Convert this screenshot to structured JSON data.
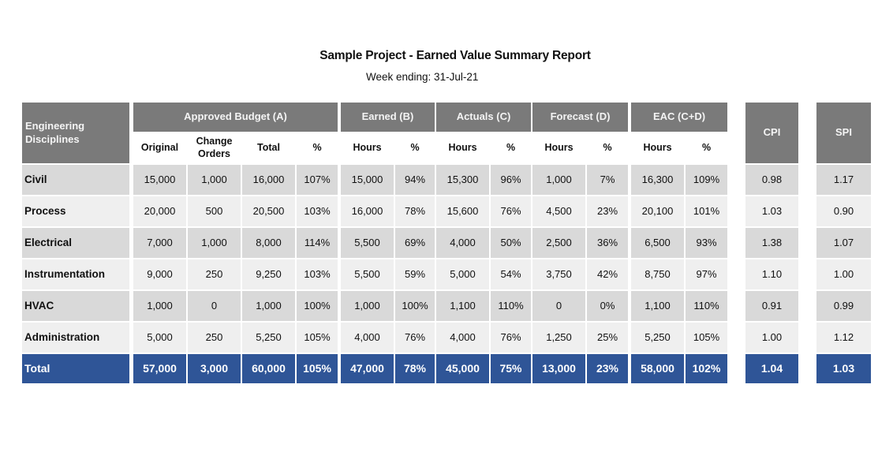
{
  "report": {
    "title": "Sample Project - Earned Value Summary Report",
    "subtitle": "Week ending:  31-Jul-21"
  },
  "colors": {
    "header_bg": "#7a7a7a",
    "row_dark": "#d9d9d9",
    "row_light": "#efefef",
    "total_bg": "#2f5597"
  },
  "headers": {
    "discipline": "Engineering Disciplines",
    "approved": "Approved Budget (A)",
    "earned": "Earned (B)",
    "actuals": "Actuals (C)",
    "forecast": "Forecast (D)",
    "eac": "EAC (C+D)",
    "cpi": "CPI",
    "spi": "SPI"
  },
  "subheaders": [
    "Original",
    "Change Orders",
    "Total",
    "%",
    "Hours",
    "%",
    "Hours",
    "%",
    "Hours",
    "%",
    "Hours",
    "%"
  ],
  "rows": [
    {
      "name": "Civil",
      "values": [
        "15,000",
        "1,000",
        "16,000",
        "107%",
        "15,000",
        "94%",
        "15,300",
        "96%",
        "1,000",
        "7%",
        "16,300",
        "109%",
        "0.98",
        "1.17"
      ]
    },
    {
      "name": "Process",
      "values": [
        "20,000",
        "500",
        "20,500",
        "103%",
        "16,000",
        "78%",
        "15,600",
        "76%",
        "4,500",
        "23%",
        "20,100",
        "101%",
        "1.03",
        "0.90"
      ]
    },
    {
      "name": "Electrical",
      "values": [
        "7,000",
        "1,000",
        "8,000",
        "114%",
        "5,500",
        "69%",
        "4,000",
        "50%",
        "2,500",
        "36%",
        "6,500",
        "93%",
        "1.38",
        "1.07"
      ]
    },
    {
      "name": "Instrumentation",
      "values": [
        "9,000",
        "250",
        "9,250",
        "103%",
        "5,500",
        "59%",
        "5,000",
        "54%",
        "3,750",
        "42%",
        "8,750",
        "97%",
        "1.10",
        "1.00"
      ]
    },
    {
      "name": "HVAC",
      "values": [
        "1,000",
        "0",
        "1,000",
        "100%",
        "1,000",
        "100%",
        "1,100",
        "110%",
        "0",
        "0%",
        "1,100",
        "110%",
        "0.91",
        "0.99"
      ]
    },
    {
      "name": "Administration",
      "values": [
        "5,000",
        "250",
        "5,250",
        "105%",
        "4,000",
        "76%",
        "4,000",
        "76%",
        "1,250",
        "25%",
        "5,250",
        "105%",
        "1.00",
        "1.12"
      ]
    }
  ],
  "total": {
    "name": "Total",
    "values": [
      "57,000",
      "3,000",
      "60,000",
      "105%",
      "47,000",
      "78%",
      "45,000",
      "75%",
      "13,000",
      "23%",
      "58,000",
      "102%",
      "1.04",
      "1.03"
    ]
  }
}
